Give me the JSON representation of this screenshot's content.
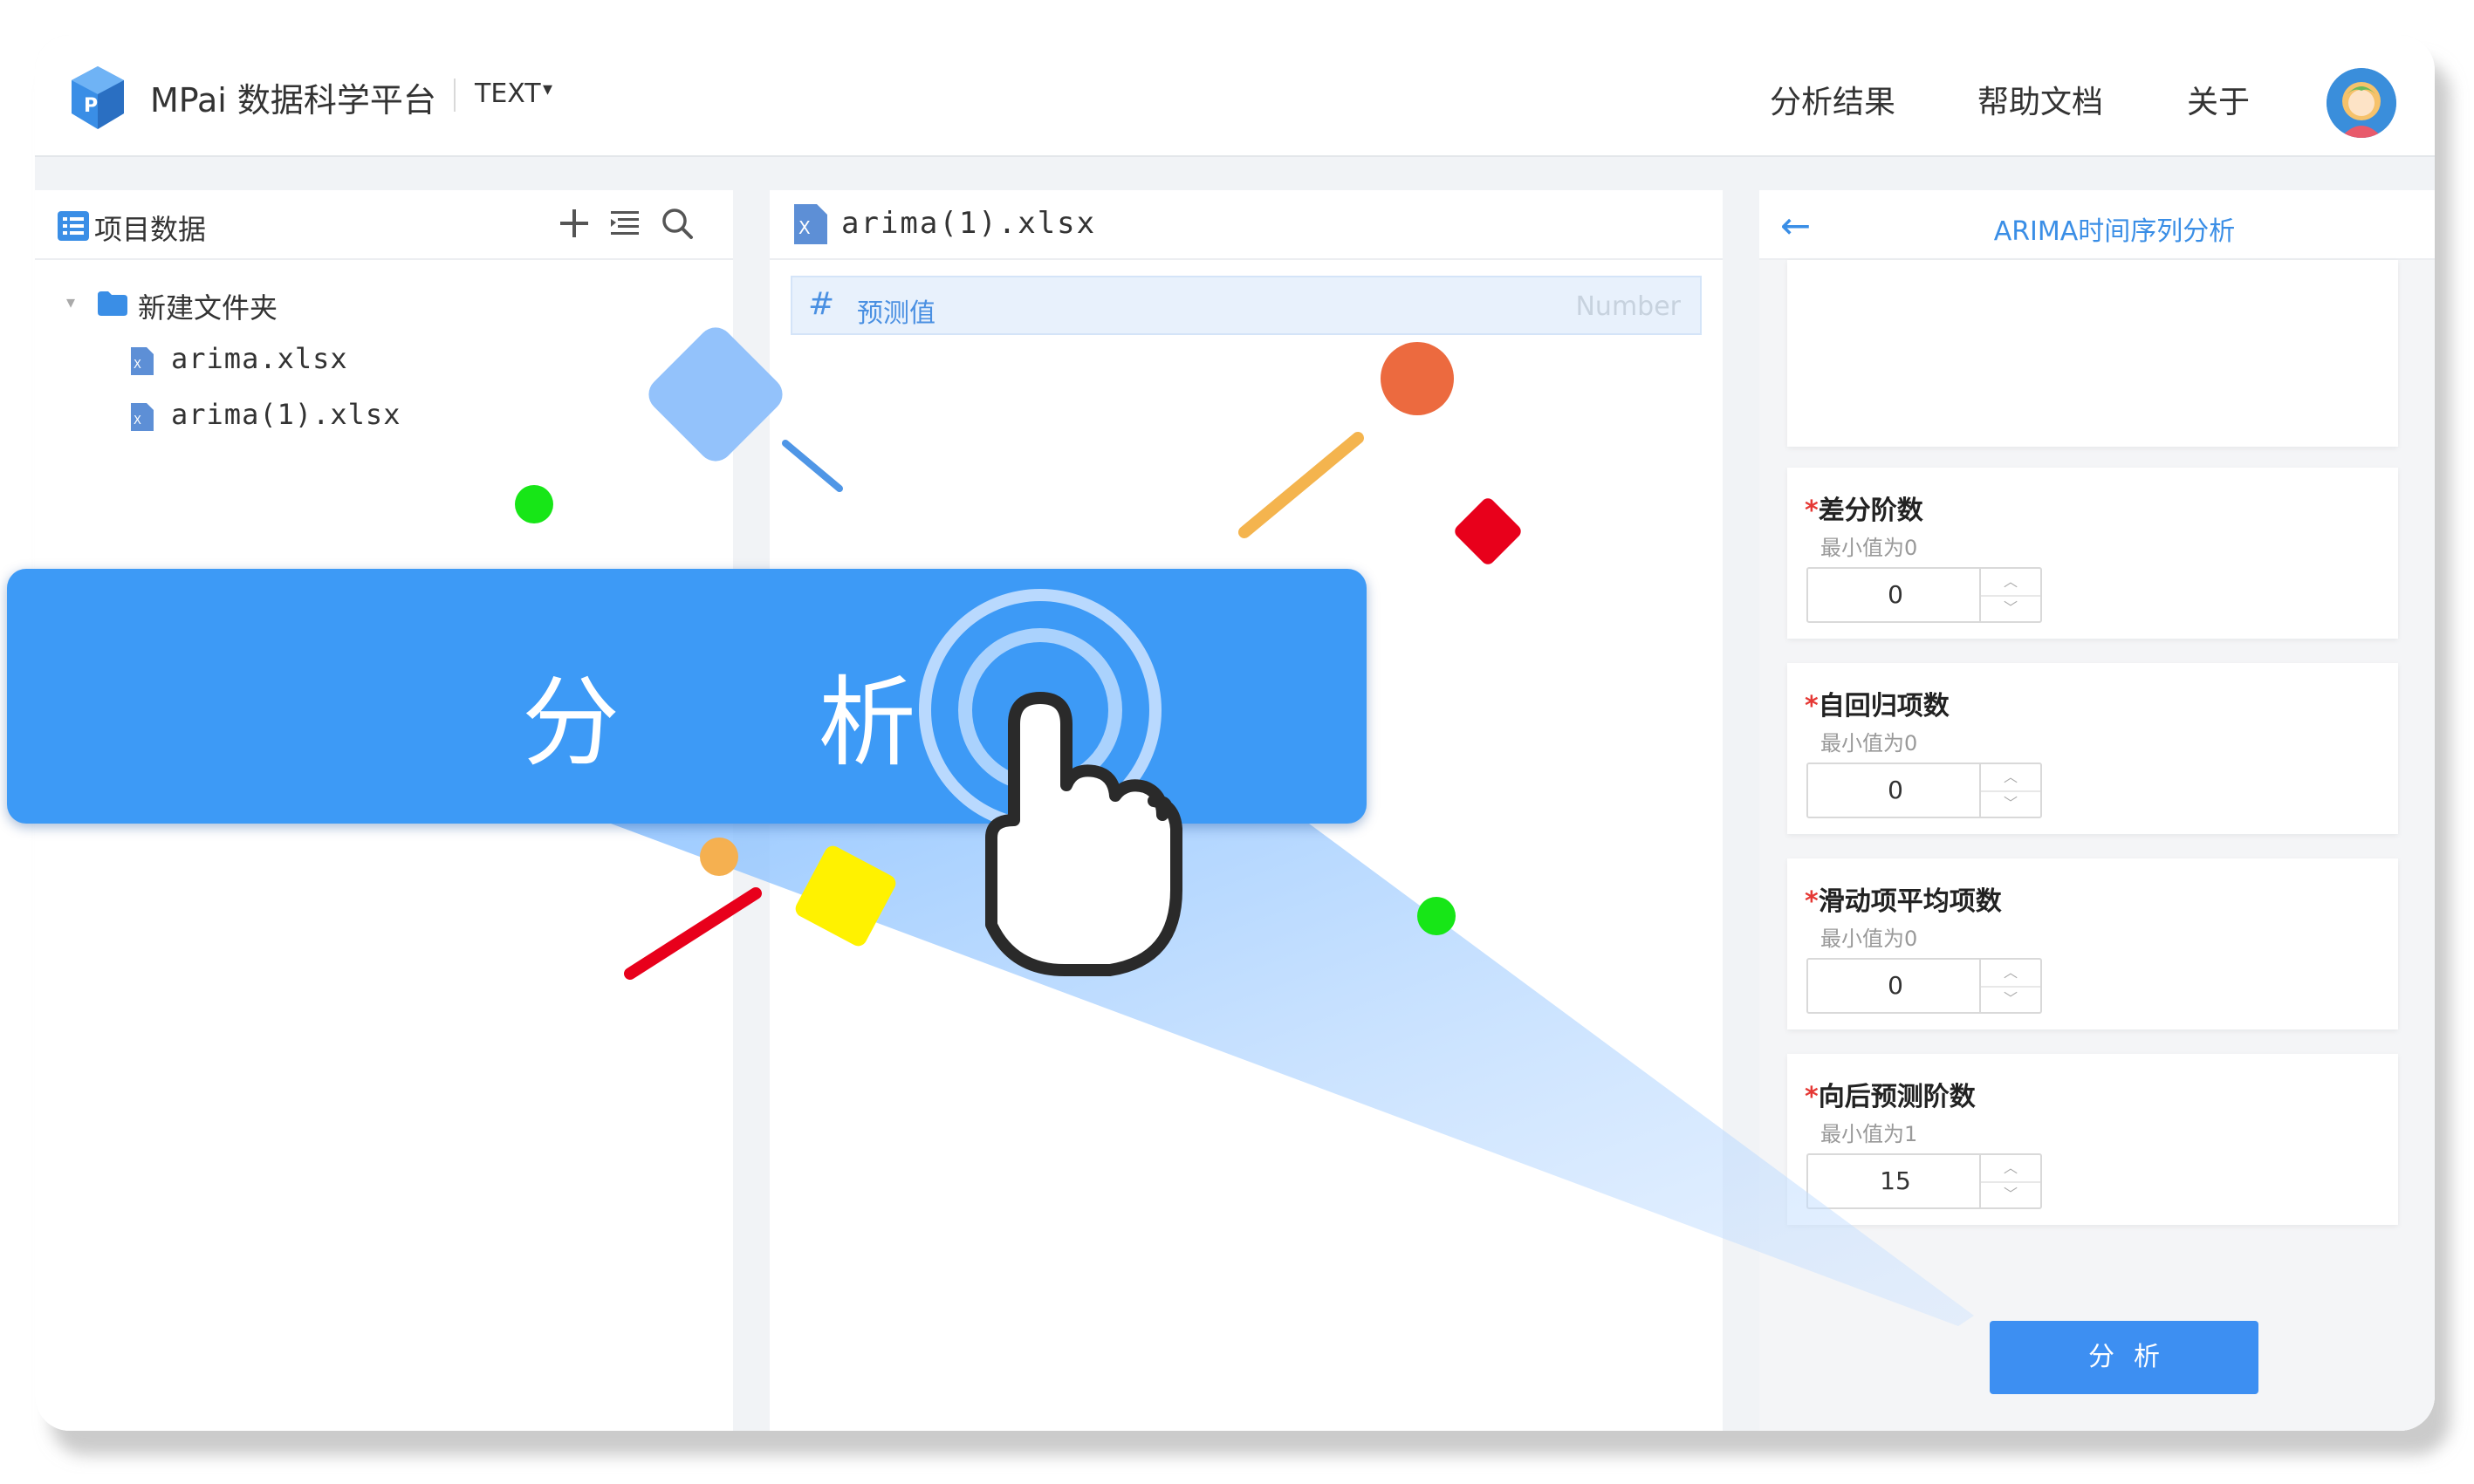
{
  "header": {
    "brand": "MPai 数据科学平台",
    "mode_label": "TEXT",
    "nav": [
      "分析结果",
      "帮助文档",
      "关于"
    ]
  },
  "left_panel": {
    "title": "项目数据",
    "folder": "新建文件夹",
    "files": [
      "arima.xlsx",
      "arima(1).xlsx"
    ]
  },
  "mid_panel": {
    "title": "arima(1).xlsx",
    "fields": [
      {
        "name": "预测值",
        "type": "Number"
      }
    ]
  },
  "right_panel": {
    "title": "ARIMA时间序列分析",
    "params": [
      {
        "label": "差分阶数",
        "hint": "最小值为0",
        "value": "0"
      },
      {
        "label": "自回归项数",
        "hint": "最小值为0",
        "value": "0"
      },
      {
        "label": "滑动项平均项数",
        "hint": "最小值为0",
        "value": "0"
      },
      {
        "label": "向后预测阶数",
        "hint": "最小值为1",
        "value": "15"
      }
    ],
    "required_mark": "*",
    "analyze_label": "分析"
  },
  "overlay": {
    "banner_label": "分 析"
  },
  "colors": {
    "accent": "#3d8ff2",
    "banner": "#3d9af6",
    "required": "#e53935"
  }
}
